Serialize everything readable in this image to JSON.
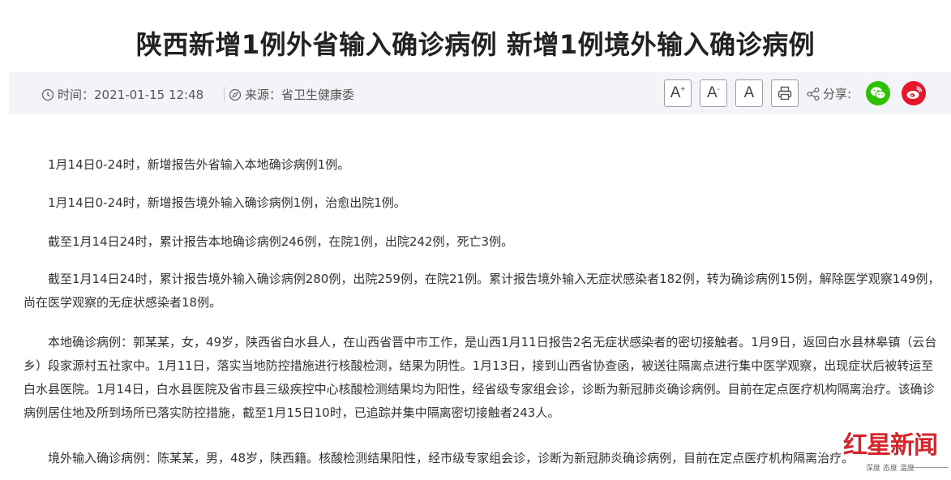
{
  "title": "陕西新增1例外省输入确诊病例 新增1例境外输入确诊病例",
  "meta": {
    "time_label": "时间：",
    "time_value": "2021-01-15 12:48",
    "source_label": "来源：",
    "source_value": "省卫生健康委",
    "share_label": "分享:"
  },
  "toolbar": {
    "font_increase": "A",
    "font_increase_sup": "+",
    "font_decrease": "A",
    "font_decrease_sup": "-",
    "font_reset": "A"
  },
  "colors": {
    "wechat": "#2dc100",
    "weibo": "#e6162d",
    "brand_red": "#d6262c",
    "meta_bg": "#f3f4f7"
  },
  "article": {
    "paragraphs": [
      "1月14日0-24时，新增报告外省输入本地确诊病例1例。",
      "1月14日0-24时，新增报告境外输入确诊病例1例，治愈出院1例。",
      "截至1月14日24时，累计报告本地确诊病例246例，在院1例，出院242例，死亡3例。",
      "截至1月14日24时，累计报告境外输入确诊病例280例，出院259例，在院21例。累计报告境外输入无症状感染者182例，转为确诊病例15例，解除医学观察149例，尚在医学观察的无症状感染者18例。",
      "本地确诊病例：郭某某，女，49岁，陕西省白水县人，在山西省晋中市工作，是山西1月11日报告2名无症状感染者的密切接触者。1月9日，返回白水县林皋镇（云台乡）段家源村五社家中。1月11日，落实当地防控措施进行核酸检测，结果为阴性。1月13日，接到山西省协查函，被送往隔离点进行集中医学观察，出现症状后被转运至白水县医院。1月14日，白水县医院及省市县三级疾控中心核酸检测结果均为阳性，经省级专家组会诊，诊断为新冠肺炎确诊病例。目前在定点医疗机构隔离治疗。该确诊病例居住地及所到场所已落实防控措施，截至1月15日10时，已追踪并集中隔离密切接触者243人。",
      "境外输入确诊病例：陈某某，男，48岁，陕西籍。核酸检测结果阳性，经市级专家组会诊，诊断为新冠肺炎确诊病例，目前在定点医疗机构隔离治疗。"
    ]
  },
  "watermark": {
    "logo": "红星新闻",
    "sub": "深度 态度 温度"
  }
}
